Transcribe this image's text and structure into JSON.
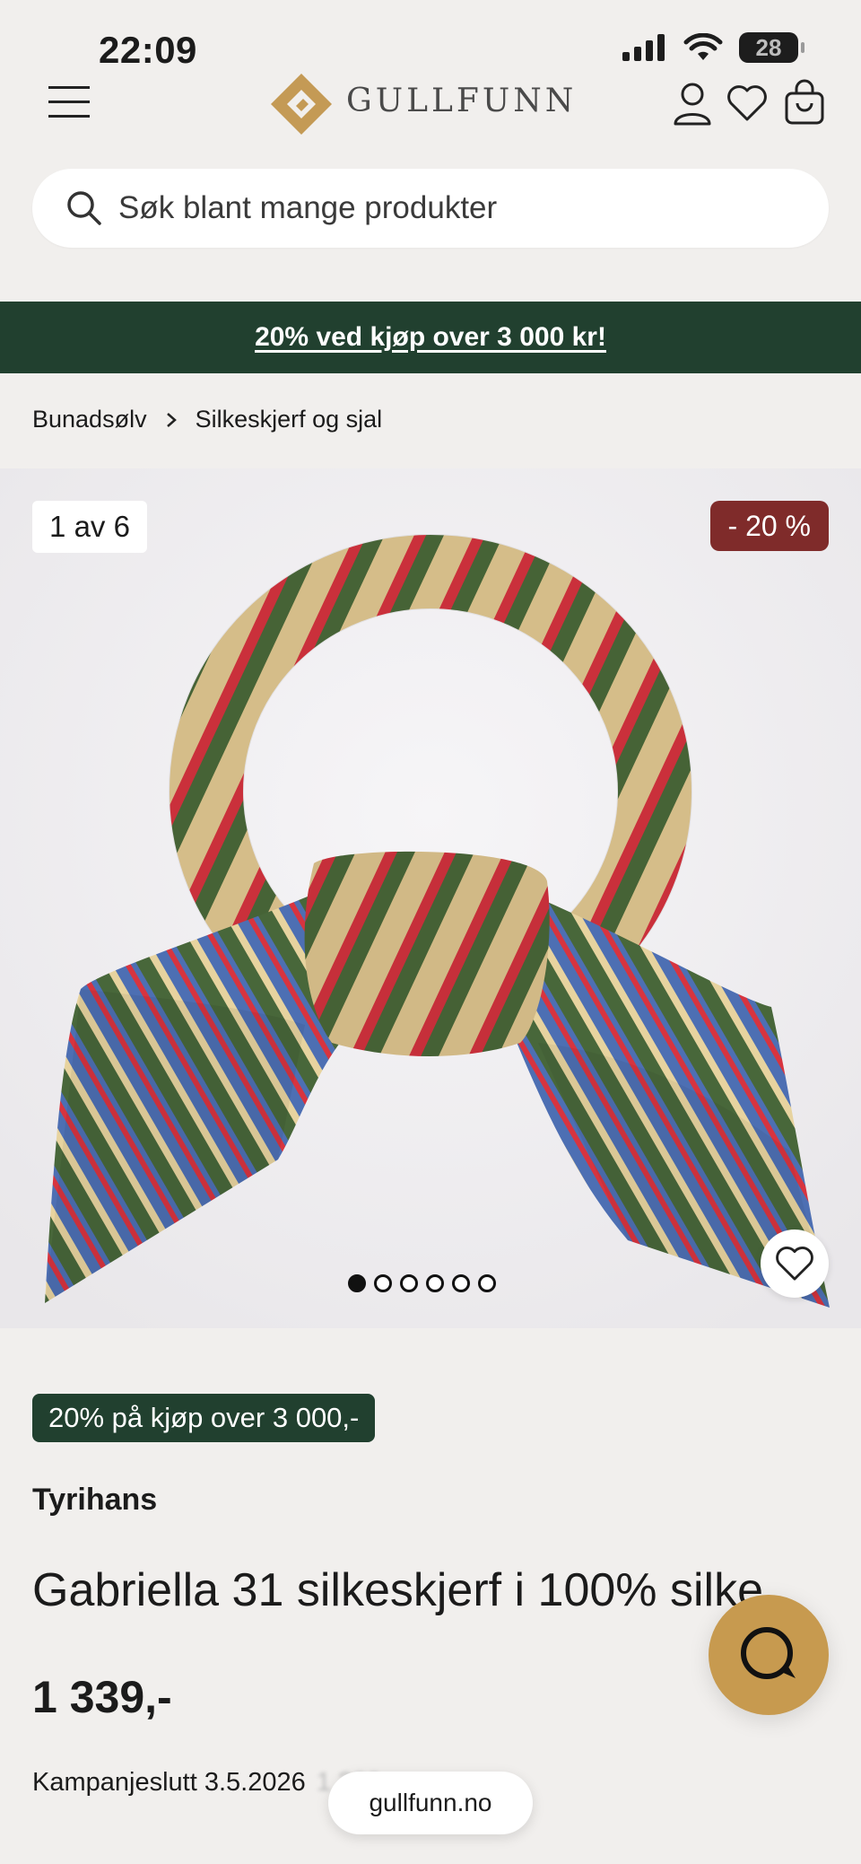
{
  "status_bar": {
    "time": "22:09",
    "battery": "28"
  },
  "header": {
    "brand": "GULLFUNN"
  },
  "search": {
    "placeholder": "Søk blant mange produkter"
  },
  "promo_banner": {
    "text": "20% ved kjøp over 3 000 kr!"
  },
  "breadcrumb": {
    "items": [
      "Bunadsølv",
      "Silkeskjerf og sjal"
    ]
  },
  "gallery": {
    "counter": "1 av 6",
    "discount": "- 20 %",
    "image_count": 6,
    "active_index": 0
  },
  "product": {
    "promo_badge": "20% på kjøp over 3 000,-",
    "brand": "Tyrihans",
    "title": "Gabriella 31 silkeskjerf i 100% silke",
    "price": "1 339,-",
    "campaign_end": "Kampanjeslutt 3.5.2026",
    "old_price": "1 339"
  },
  "browser": {
    "url": "gullfunn.no"
  },
  "colors": {
    "primary_green": "#21402f",
    "discount_red": "#7f2b2a",
    "gold": "#c79a4f"
  }
}
